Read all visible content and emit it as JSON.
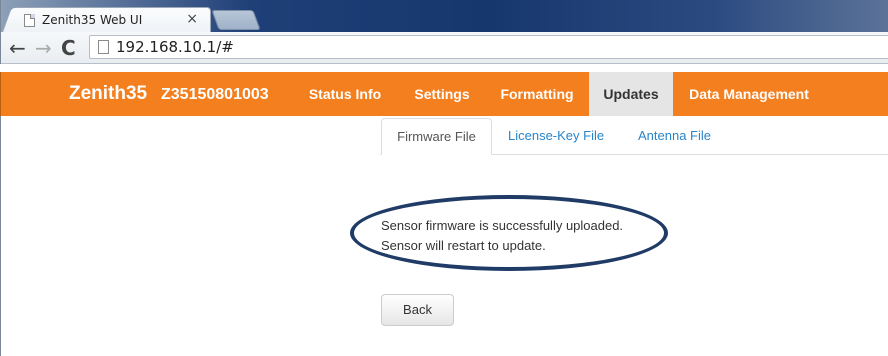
{
  "browser": {
    "tab_title": "Zenith35 Web UI",
    "tab_close": "×",
    "url": "192.168.10.1/#",
    "back_glyph": "←",
    "forward_glyph": "→",
    "reload_glyph": "C"
  },
  "app": {
    "brand": "Zenith35",
    "serial": "Z35150801003",
    "nav": [
      "Status Info",
      "Settings",
      "Formatting",
      "Updates",
      "Data Management"
    ],
    "active_nav": "Updates",
    "accent_color": "#f47f1e"
  },
  "subtabs": [
    "Firmware File",
    "License-Key File",
    "Antenna File"
  ],
  "active_subtab": "Firmware File",
  "message": {
    "line1": "Sensor firmware is successfully uploaded.",
    "line2": "Sensor will restart to update."
  },
  "back_button": "Back",
  "icons": {
    "tab_favicon": "page-icon",
    "omnibox_icon": "page-icon",
    "annotation": "ellipse-highlight"
  }
}
